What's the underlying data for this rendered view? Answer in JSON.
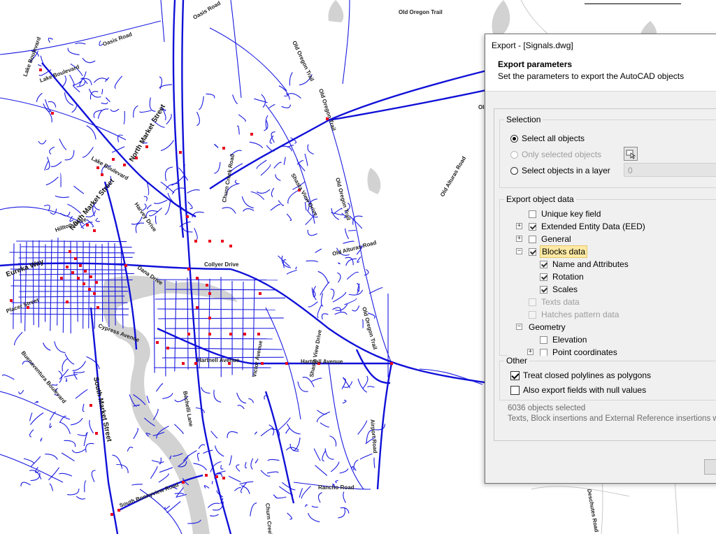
{
  "map": {
    "labels": [
      {
        "text": "Oasis Road"
      },
      {
        "text": "Oasis Road"
      },
      {
        "text": "Old Oregon Trail"
      },
      {
        "text": "Old Oregon Trail"
      },
      {
        "text": "Old Oregon Trail"
      },
      {
        "text": "Old Oregon Trail"
      },
      {
        "text": "Lake Boulevard"
      },
      {
        "text": "Lake Boulevard"
      },
      {
        "text": "Lake Boulevard"
      },
      {
        "text": "North Market Street"
      },
      {
        "text": "North Market Street"
      },
      {
        "text": "Hilltop Drive"
      },
      {
        "text": "Harvey Drive"
      },
      {
        "text": "Collyer Drive"
      },
      {
        "text": "Churn Creek Road"
      },
      {
        "text": "Shasta View Drive"
      },
      {
        "text": "Old Alturas Road"
      },
      {
        "text": "Old Alturas Road"
      },
      {
        "text": "Old Oregon Trail"
      },
      {
        "text": "Eureka Way"
      },
      {
        "text": "Placer Street"
      },
      {
        "text": "Dana Drive"
      },
      {
        "text": "Cypress Avenue"
      },
      {
        "text": "Hartnell Avenue"
      },
      {
        "text": "Hartnell Avenue"
      },
      {
        "text": "Victor Avenue"
      },
      {
        "text": "South Market Street"
      },
      {
        "text": "Buenaventura Boulevard"
      },
      {
        "text": "Bechelli Lane"
      },
      {
        "text": "Shasta View Drive"
      },
      {
        "text": "Airport Road"
      },
      {
        "text": "Rancho Road"
      },
      {
        "text": "South Bonnyview Road"
      },
      {
        "text": "Churn Creek Road"
      },
      {
        "text": "Deschutes Road"
      },
      {
        "text": "Old"
      }
    ]
  },
  "dialog": {
    "title": "Export -  [Signals.dwg]",
    "header_title": "Export parameters",
    "header_subtitle": "Set the parameters to export the AutoCAD objects",
    "selection": {
      "group_title": "Selection",
      "select_all": "Select all objects",
      "only_selected": "Only selected objects",
      "select_in_layer": "Select objects in a layer",
      "layer_value": "0"
    },
    "object_data": {
      "group_title": "Export object data",
      "items": [
        {
          "label": "Unique key field",
          "checked": false
        },
        {
          "label": "Extended Entity Data (EED)",
          "checked": true
        },
        {
          "label": "General",
          "checked": false
        },
        {
          "label": "Blocks data",
          "checked": true
        },
        {
          "label": "Name and Attributes",
          "checked": true
        },
        {
          "label": "Rotation",
          "checked": true
        },
        {
          "label": "Scales",
          "checked": true
        },
        {
          "label": "Texts data",
          "checked": false
        },
        {
          "label": "Hatches pattern data",
          "checked": false
        },
        {
          "label": "Geometry"
        },
        {
          "label": "Elevation",
          "checked": false
        },
        {
          "label": "Point coordinates",
          "checked": false
        }
      ]
    },
    "other": {
      "group_title": "Other",
      "closed_polylines": "Treat closed polylines as polygons",
      "null_values": "Also export fields with null values"
    },
    "status_count": "6036 objects selected",
    "status_note": "Texts, Block insertions and External Reference insertions will be"
  },
  "colors": {
    "road": "#1010d8",
    "signal": "#e8001c",
    "river": "#cfcfcf"
  }
}
